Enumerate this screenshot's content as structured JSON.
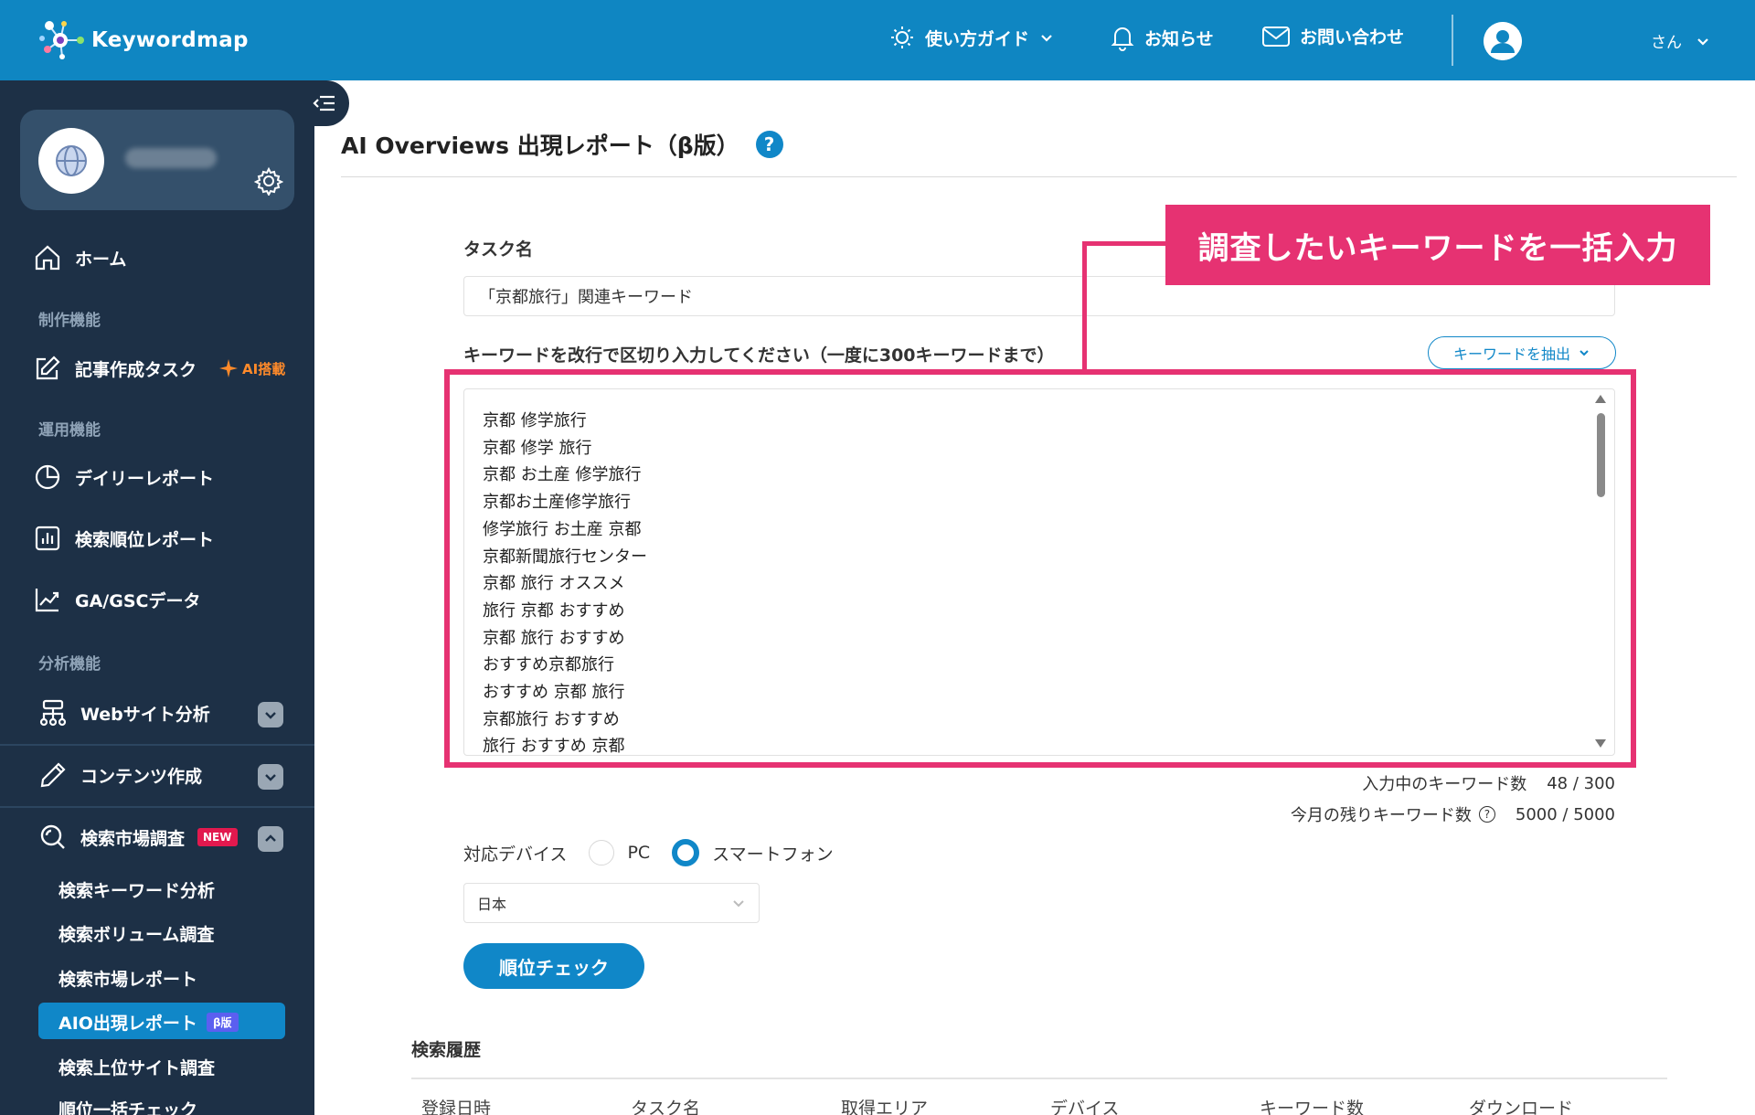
{
  "header": {
    "logo_text": "Keywordmap",
    "nav": [
      {
        "label": "使い方ガイド",
        "icon": "lightbulb-icon"
      },
      {
        "label": "お知らせ",
        "icon": "bell-icon"
      },
      {
        "label": "お問い合わせ",
        "icon": "mail-icon"
      }
    ],
    "user_label": "さん"
  },
  "sidebar": {
    "sections": {
      "production": "制作機能",
      "operation": "運用機能",
      "analysis": "分析機能"
    },
    "items": {
      "home": "ホーム",
      "article_task": "記事作成タスク",
      "ai_badge": "AI搭載",
      "daily_report": "デイリーレポート",
      "rank_report": "検索順位レポート",
      "ga_gsc": "GA/GSCデータ",
      "website_analysis": "Webサイト分析",
      "content_creation": "コンテンツ作成",
      "market_research": "検索市場調査",
      "new_badge": "NEW"
    },
    "sub_items": [
      "検索キーワード分析",
      "検索ボリューム調査",
      "検索市場レポート",
      "AIO出現レポート",
      "検索上位サイト調査",
      "順位一括チェック"
    ],
    "beta_badge": "β版"
  },
  "main": {
    "title": "AI Overviews 出現レポート（β版）",
    "help": "?",
    "task_label": "タスク名",
    "task_value": "「京都旅行」関連キーワード",
    "keywords_label": "キーワードを改行で区切り入力してください（一度に300キーワードまで）",
    "extract_button": "キーワードを抽出",
    "keywords": [
      "京都 修学旅行",
      "京都 修学 旅行",
      "京都 お土産 修学旅行",
      "京都お土産修学旅行",
      "修学旅行 お土産 京都",
      "京都新聞旅行センター",
      "京都 旅行 オススメ",
      "旅行 京都 おすすめ",
      "京都 旅行 おすすめ",
      "おすすめ京都旅行",
      "おすすめ 京都 旅行",
      "京都旅行 おすすめ",
      "旅行 おすすめ 京都"
    ],
    "callout": "調査したいキーワードを一括入力",
    "count_label": "入力中のキーワード数",
    "count_value": "48 / 300",
    "remaining_label": "今月の残りキーワード数",
    "remaining_value": "5000 / 5000",
    "device_label": "対応デバイス",
    "device_pc": "PC",
    "device_sp": "スマートフォン",
    "country": "日本",
    "check_button": "順位チェック",
    "history_title": "検索履歴",
    "history_columns": [
      "登録日時",
      "タスク名",
      "取得エリア",
      "デバイス",
      "キーワード数",
      "ダウンロード"
    ]
  },
  "colors": {
    "header": "#0f86c2",
    "sidebar": "#1d3046",
    "accent": "#1087c8",
    "highlight": "#e63272"
  }
}
